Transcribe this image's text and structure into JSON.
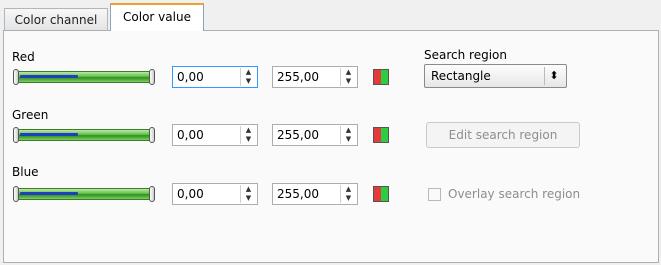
{
  "tabs": [
    {
      "label": "Color channel",
      "active": false
    },
    {
      "label": "Color value",
      "active": true
    }
  ],
  "channels": [
    {
      "name": "Red",
      "min": "0,00",
      "max": "255,00",
      "fill": 0.45
    },
    {
      "name": "Green",
      "min": "0,00",
      "max": "255,00",
      "fill": 0.45
    },
    {
      "name": "Blue",
      "min": "0,00",
      "max": "255,00",
      "fill": 0.45
    }
  ],
  "search_region": {
    "label": "Search region",
    "selected": "Rectangle"
  },
  "edit_button": "Edit search region",
  "overlay_label": "Overlay search region",
  "colors": {
    "accent": "#f0a030",
    "slider_green": "#62c24a",
    "slider_fill": "#1f3fbf",
    "disabled_text": "#8d8d8d"
  },
  "icons": {
    "spin_arrows": "up-down-arrow-icon",
    "swatch": "color-swatch-icon",
    "dropdown": "updown-chevron-icon"
  }
}
